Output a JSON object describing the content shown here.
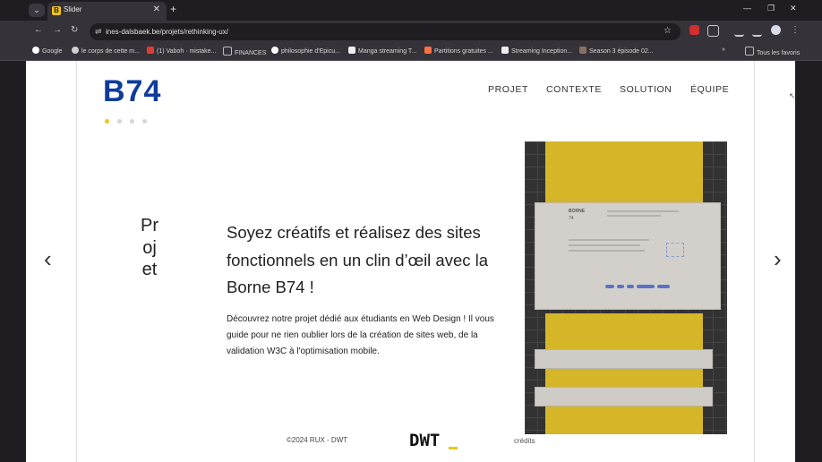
{
  "browser": {
    "tab_title": "Slider",
    "tab_icon_letter": "B",
    "url": "ines-dalsbaek.be/projets/rethinking-ux/",
    "bookmarks": [
      {
        "label": "Google",
        "color": "#ffffff"
      },
      {
        "label": "le corps de cette m...",
        "color": "#cfcfcf"
      },
      {
        "label": "(1) Vaboh · mistake...",
        "color": "#e53935"
      },
      {
        "label": "FINANCES",
        "color": "#9e9e9e"
      },
      {
        "label": "philosophie d'Epicu...",
        "color": "#ffffff"
      },
      {
        "label": "Manga streaming T...",
        "color": "#eeeeee"
      },
      {
        "label": "Partitions gratuites ...",
        "color": "#ff7043"
      },
      {
        "label": "Streaming Inception...",
        "color": "#eeeeee"
      },
      {
        "label": "Season 3 épisode 02...",
        "color": "#8d6e63"
      },
      {
        "label": "Tous les favoris",
        "color": "#9e9e9e"
      }
    ]
  },
  "site": {
    "logo": "B74",
    "nav": [
      "PROJET",
      "CONTEXTE",
      "SOLUTION",
      "ÉQUIPE"
    ],
    "slider_dots": 4,
    "active_dot": 0,
    "vertical_label": "Projet",
    "headline": "Soyez créatifs et réalisez des sites fonctionnels en un clin d’œil avec la Borne B74 !",
    "description": "Découvrez notre projet dédié aux étudiants en Web Design ! Il vous guide pour ne rien oublier lors de la création de sites web, de la validation W3C à l'optimisation mobile.",
    "prev_arrow": "‹",
    "next_arrow": "›",
    "preview_title": "BORNE",
    "preview_sub": "74",
    "footer_copyright": "©2024 RUX - DWT",
    "footer_logo": "DWT",
    "footer_credits": "crédits",
    "colors": {
      "brand_blue": "#0d3c9b",
      "accent_yellow": "#f0c419"
    }
  }
}
